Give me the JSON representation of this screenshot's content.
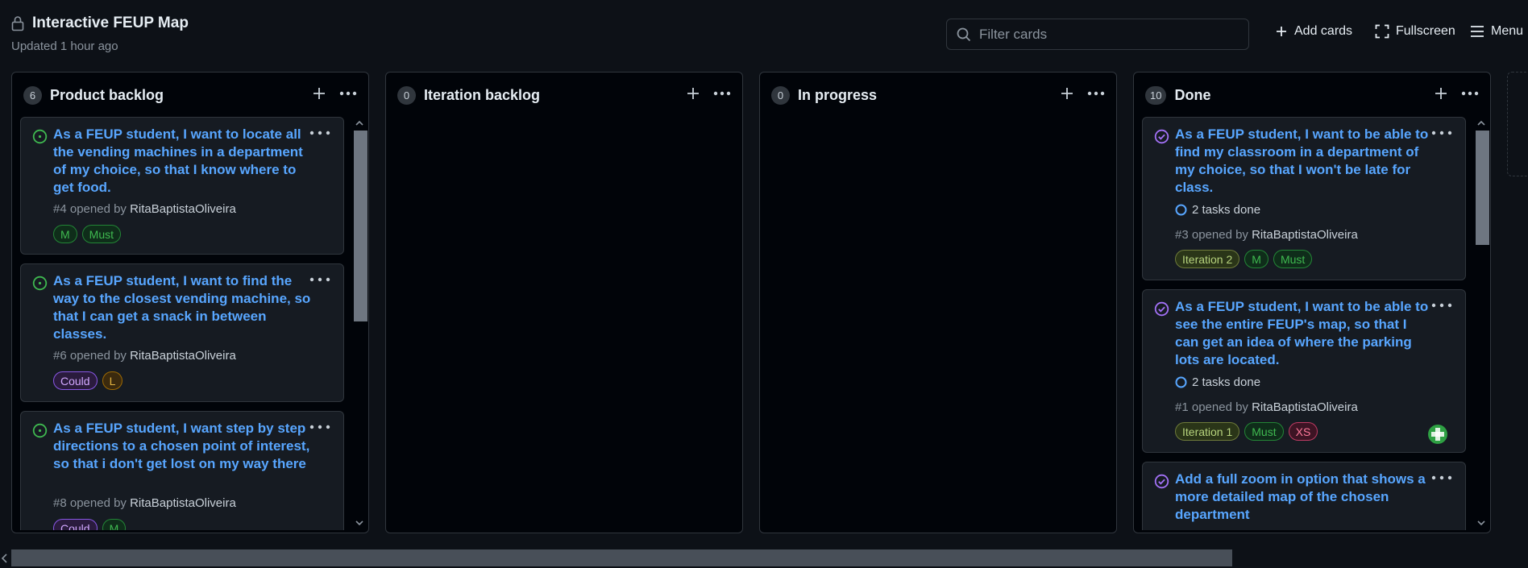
{
  "header": {
    "title": "Interactive FEUP Map",
    "updated": "Updated 1 hour ago",
    "filter_placeholder": "Filter cards",
    "add_cards": "Add cards",
    "fullscreen": "Fullscreen",
    "menu": "Menu"
  },
  "columns": [
    {
      "name": "Product backlog",
      "count": "6",
      "cards": [
        {
          "title": "As a FEUP student, I want to locate all the vending machines in a department of my choice, so that I know where to get food.",
          "ref": "#4 opened by ",
          "author": "RitaBaptistaOliveira",
          "labels": [
            "M",
            "Must"
          ]
        },
        {
          "title": "As a FEUP student, I want to find the way to the closest vending machine, so that I can get a snack in between classes.",
          "ref": "#6 opened by ",
          "author": "RitaBaptistaOliveira",
          "labels": [
            "Could",
            "L"
          ]
        },
        {
          "title": "As a FEUP student, I want step by step directions to a chosen point of interest, so that i don't get lost on my way there",
          "ref": "#8 opened by ",
          "author": "RitaBaptistaOliveira",
          "labels": [
            "Could",
            "M"
          ]
        }
      ]
    },
    {
      "name": "Iteration backlog",
      "count": "0",
      "cards": []
    },
    {
      "name": "In progress",
      "count": "0",
      "cards": []
    },
    {
      "name": "Done",
      "count": "10",
      "cards": [
        {
          "title": "As a FEUP student, I want to be able to find my classroom in a department of my choice, so that I won't be late for class.",
          "tasks": "2 tasks done",
          "ref": "#3 opened by ",
          "author": "RitaBaptistaOliveira",
          "labels": [
            "Iteration 2",
            "M",
            "Must"
          ]
        },
        {
          "title": "As a FEUP student, I want to be able to see the entire FEUP's map, so that I can get an idea of where the parking lots are located.",
          "tasks": "2 tasks done",
          "ref": "#1 opened by ",
          "author": "RitaBaptistaOliveira",
          "labels": [
            "Iteration 1",
            "Must",
            "XS"
          ]
        },
        {
          "title": "Add a full zoom in option that shows a more detailed map of the chosen department"
        }
      ]
    }
  ],
  "colors": {
    "open_icon": "#3fb950",
    "closed_icon": "#a371f7",
    "link": "#58a6ff"
  }
}
